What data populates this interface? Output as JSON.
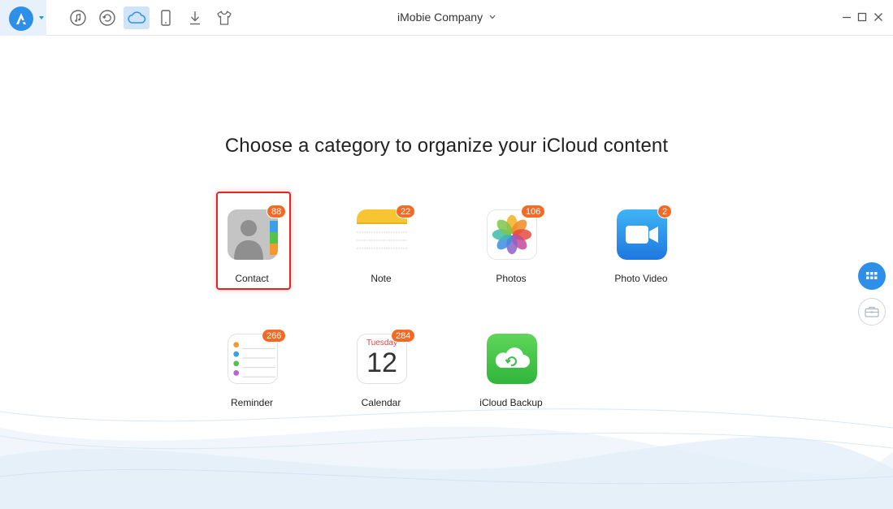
{
  "window": {
    "title": "iMobie Company"
  },
  "toolbar": {
    "tools": [
      {
        "icon": "music-icon",
        "active": false
      },
      {
        "icon": "restore-icon",
        "active": false
      },
      {
        "icon": "cloud-icon",
        "active": true
      },
      {
        "icon": "phone-icon",
        "active": false
      },
      {
        "icon": "download-icon",
        "active": false
      },
      {
        "icon": "tshirt-icon",
        "active": false
      }
    ]
  },
  "main": {
    "heading": "Choose a category to organize your iCloud content",
    "categories": [
      {
        "label": "Contact",
        "count": "88",
        "selected": true
      },
      {
        "label": "Note",
        "count": "22"
      },
      {
        "label": "Photos",
        "count": "106"
      },
      {
        "label": "Photo Video",
        "count": "2"
      },
      {
        "label": "Reminder",
        "count": "266"
      },
      {
        "label": "Calendar",
        "count": "284",
        "calendar_day": "Tuesday",
        "calendar_date": "12"
      },
      {
        "label": "iCloud Backup"
      }
    ]
  },
  "colors": {
    "accent": "#2e8fe8",
    "badge": "#f36a24",
    "selection": "#e12424"
  }
}
